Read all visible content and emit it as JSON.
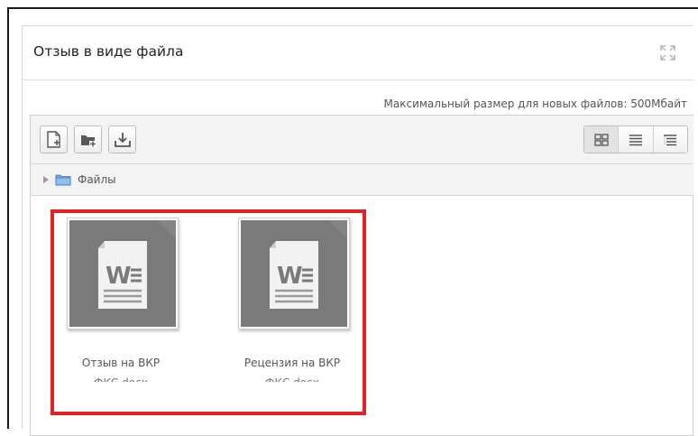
{
  "panel": {
    "title": "Отзыв в виде файла",
    "expand_icon": "fullscreen-expand-icon"
  },
  "filemanager": {
    "max_size_text": "Максимальный размер для новых файлов: 500Мбайт",
    "toolbar": {
      "buttons": [
        {
          "name": "add-file-button",
          "icon": "new-file-icon"
        },
        {
          "name": "create-folder-button",
          "icon": "new-folder-icon"
        },
        {
          "name": "download-button",
          "icon": "download-icon"
        }
      ],
      "view_modes": [
        {
          "name": "view-icons",
          "icon": "grid-view-icon",
          "active": true
        },
        {
          "name": "view-list",
          "icon": "list-view-icon",
          "active": false
        },
        {
          "name": "view-tree",
          "icon": "tree-view-icon",
          "active": false
        }
      ]
    },
    "path": {
      "folder_label": "Файлы"
    },
    "files": [
      {
        "name_line1": "Отзыв на ВКР",
        "name_line2": "ФКС.docx",
        "icon": "word-document-icon"
      },
      {
        "name_line1": "Рецензия на ВКР",
        "name_line2": "ФКС.docx",
        "icon": "word-document-icon"
      }
    ]
  },
  "colors": {
    "highlight": "#e32228",
    "thumb_bg": "#7a7a7a",
    "toolbar_bg": "#f3f3f3"
  }
}
